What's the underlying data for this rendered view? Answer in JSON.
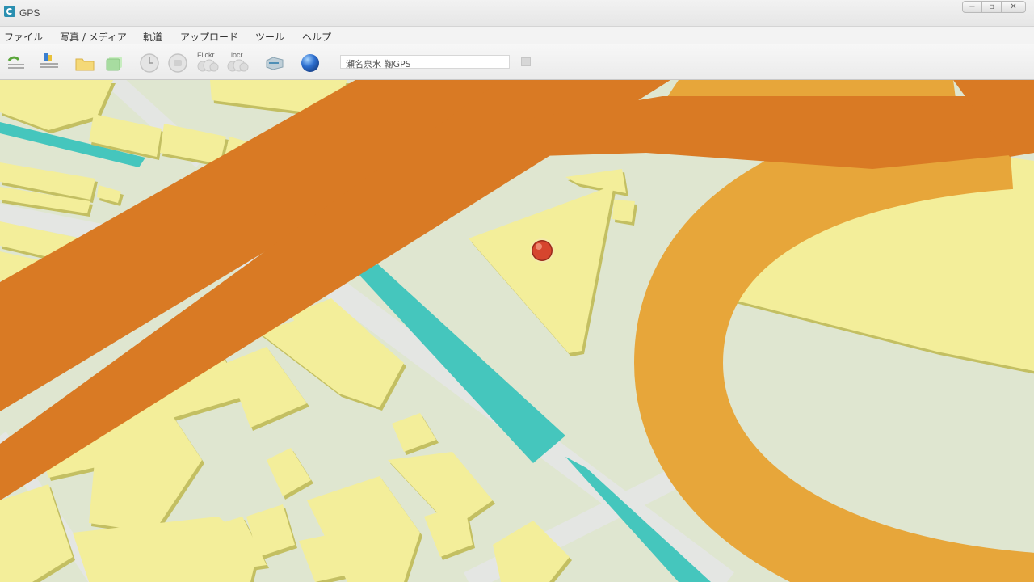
{
  "window": {
    "title": "GPS"
  },
  "window_controls": [
    "−",
    "▫",
    "✕"
  ],
  "menu": [
    {
      "label": "ファイル"
    },
    {
      "label": "写真 / メディア"
    },
    {
      "label": "軌道"
    },
    {
      "label": "アップロード"
    },
    {
      "label": "ツール"
    },
    {
      "label": "ヘルプ"
    }
  ],
  "toolbar": {
    "flickr_label": "Flickr",
    "locr_label": "locr",
    "search_value": "瀬名泉水 鞠GPS"
  },
  "map": {
    "colors": {
      "ground": "#dfe6d0",
      "building": "#f3ee9a",
      "building_edge": "#c9c46a",
      "road": "#e4e6e3",
      "highway": "#d97a24",
      "ramp": "#e7a63a",
      "water": "#45c6bd"
    },
    "marker_color": "#d6452e"
  }
}
